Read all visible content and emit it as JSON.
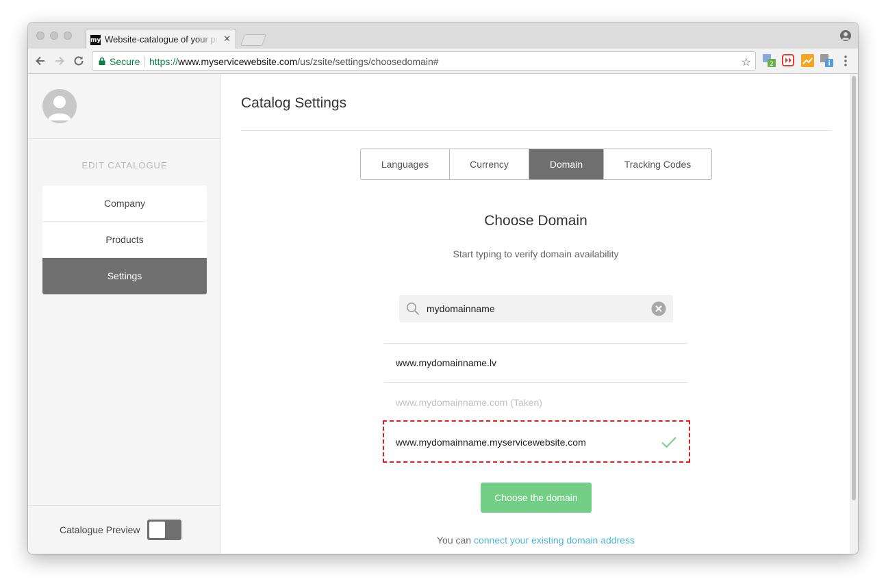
{
  "browser": {
    "tab_title": "Website-catalogue of your product",
    "tab_favicon_text": "my",
    "secure_label": "Secure",
    "url_protocol": "https://",
    "url_host": "www.myservicewebsite.com",
    "url_path": "/us/zsite/settings/choosedomain#"
  },
  "sidebar": {
    "section_label": "EDIT CATALOGUE",
    "items": [
      {
        "label": "Company",
        "active": false
      },
      {
        "label": "Products",
        "active": false
      },
      {
        "label": "Settings",
        "active": true
      }
    ],
    "preview_label": "Catalogue Preview",
    "preview_enabled": false
  },
  "main": {
    "title": "Catalog Settings",
    "tabs": [
      {
        "label": "Languages",
        "active": false
      },
      {
        "label": "Currency",
        "active": false
      },
      {
        "label": "Domain",
        "active": true
      },
      {
        "label": "Tracking Codes",
        "active": false
      }
    ],
    "heading": "Choose Domain",
    "hint": "Start typing to verify domain availability",
    "search_value": "mydomainname",
    "results": [
      {
        "domain": "www.mydomainname.lv",
        "status": "available"
      },
      {
        "domain": "www.mydomainname.com (Taken)",
        "status": "taken"
      },
      {
        "domain": "www.mydomainname.myservicewebsite.com",
        "status": "selected"
      }
    ],
    "choose_button": "Choose the domain",
    "connect_prefix": "You can",
    "connect_link": "connect your existing domain address"
  },
  "colors": {
    "accent_green": "#74cf86",
    "active_gray": "#6f6f6f",
    "link_blue": "#4fb6d7",
    "highlight_red": "#e31b1b",
    "secure_green": "#0b8043"
  }
}
